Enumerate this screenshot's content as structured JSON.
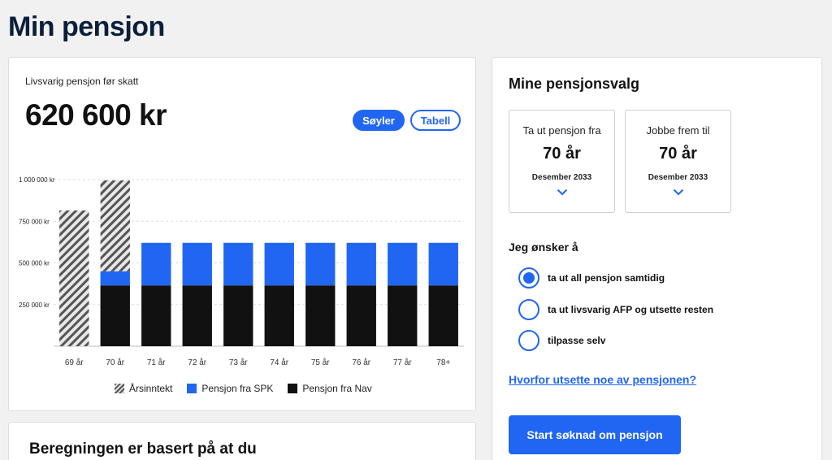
{
  "page": {
    "title": "Min pensjon"
  },
  "summary": {
    "subtitle": "Livsvarig pensjon før skatt",
    "amount": "620 600 kr",
    "view_toggle": {
      "bars_label": "Søyler",
      "table_label": "Tabell",
      "selected": "Søyler"
    }
  },
  "chart_data": {
    "type": "bar",
    "stacked": true,
    "categories": [
      "69 år",
      "70 år",
      "71 år",
      "72 år",
      "73 år",
      "74 år",
      "75 år",
      "76 år",
      "77 år",
      "78+"
    ],
    "series": [
      {
        "name": "Pensjon fra Nav",
        "color": "#111111",
        "values": [
          0,
          365000,
          365000,
          365000,
          365000,
          365000,
          365000,
          365000,
          365000,
          365000
        ]
      },
      {
        "name": "Pensjon fra SPK",
        "color": "#2166f3",
        "values": [
          0,
          85000,
          255600,
          255600,
          255600,
          255600,
          255600,
          255600,
          255600,
          255600
        ]
      },
      {
        "name": "Årsinntekt",
        "color": "hatched",
        "values": [
          815000,
          545000,
          0,
          0,
          0,
          0,
          0,
          0,
          0,
          0
        ]
      }
    ],
    "y_ticks": [
      "1 000 000 kr",
      "750 000 kr",
      "500 000 kr",
      "250 000 kr"
    ],
    "y_tick_values": [
      1000000,
      750000,
      500000,
      250000
    ],
    "ylim": [
      0,
      1000000
    ],
    "grid": true,
    "legend": {
      "placement": "bottom",
      "items": [
        "Årsinntekt",
        "Pensjon fra SPK",
        "Pensjon fra Nav"
      ]
    }
  },
  "choices": {
    "title": "Mine pensjonsvalg",
    "start": {
      "label": "Ta ut pensjon fra",
      "value": "70 år",
      "date": "Desember 2033"
    },
    "work": {
      "label": "Jobbe frem til",
      "value": "70 år",
      "date": "Desember 2033"
    }
  },
  "wish": {
    "title": "Jeg ønsker å",
    "options": [
      {
        "label": "ta ut all pensjon samtidig",
        "checked": true
      },
      {
        "label": "ta ut livsvarig AFP og utsette resten",
        "checked": false
      },
      {
        "label": "tilpasse selv",
        "checked": false
      }
    ]
  },
  "help_link": "Hvorfor utsette noe av pensjonen?",
  "cta": "Start søknad om pensjon",
  "basis": {
    "title": "Beregningen er basert på at du"
  },
  "colors": {
    "accent": "#2166f3",
    "title": "#0b1f3a"
  }
}
